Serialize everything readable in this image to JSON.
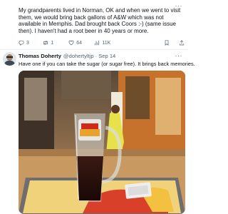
{
  "tweet1": {
    "text": "My grandparents lived in Norman, OK and when we went to visit them, we would bring back gallons of A&W which was not available in Memphis. Dad brought back Coors :-) (same issue then). I haven't had a root beer in 40 years or more.",
    "actions": {
      "replies": "3",
      "retweets": "1",
      "likes": "64",
      "views": "11K"
    },
    "more_icon": "more-horizontal-icon"
  },
  "tweet2": {
    "author_name": "Thomas Doherty",
    "handle": "@dohertyltjp",
    "separator": "·",
    "date": "Sep 14",
    "text": "Have one if you can take the sugar (or sugar free). It brings back memories.",
    "more_icon": "more-horizontal-icon"
  },
  "photo": {
    "mug_text": "AM FRESH ROOT BEER",
    "wrapper_text": "GOOD FOR"
  },
  "colors": {
    "text": "#0f1419",
    "secondary": "#536471",
    "divider": "#eff3f4"
  }
}
